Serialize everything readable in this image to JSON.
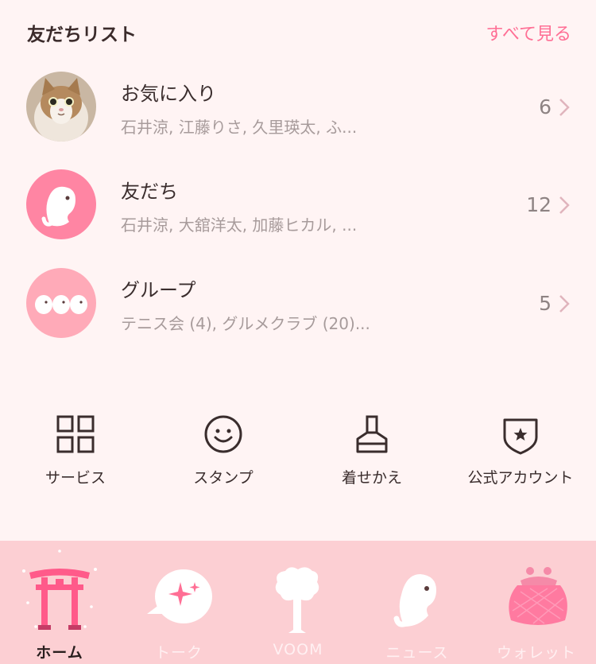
{
  "header": {
    "title": "友だちリスト",
    "see_all": "すべて見る"
  },
  "friend_list": [
    {
      "name": "お気に入り",
      "members": "石井涼, 江藤りさ, 久里瑛太, ふ...",
      "count": "6"
    },
    {
      "name": "友だち",
      "members": "石井涼, 大舘洋太, 加藤ヒカル, ...",
      "count": "12"
    },
    {
      "name": "グループ",
      "members": "テニス会 (4), グルメクラブ (20)...",
      "count": "5"
    }
  ],
  "services": [
    {
      "label": "サービス",
      "icon": "grid-icon"
    },
    {
      "label": "スタンプ",
      "icon": "smiley-icon"
    },
    {
      "label": "着せかえ",
      "icon": "brush-icon"
    },
    {
      "label": "公式アカウント",
      "icon": "shield-star-icon"
    }
  ],
  "tabs": [
    {
      "label": "ホーム",
      "icon": "torii-icon",
      "active": true
    },
    {
      "label": "トーク",
      "icon": "chat-bubble-icon",
      "active": false
    },
    {
      "label": "VOOM",
      "icon": "tree-icon",
      "active": false
    },
    {
      "label": "ニュース",
      "icon": "ghost-icon",
      "active": false
    },
    {
      "label": "ウォレット",
      "icon": "coin-purse-icon",
      "active": false
    }
  ],
  "colors": {
    "background": "#fff4f4",
    "accent": "#ff6f95",
    "tabbar": "#fccfd3",
    "avatar_friends": "#ff85a3",
    "avatar_groups": "#ffaab8"
  }
}
